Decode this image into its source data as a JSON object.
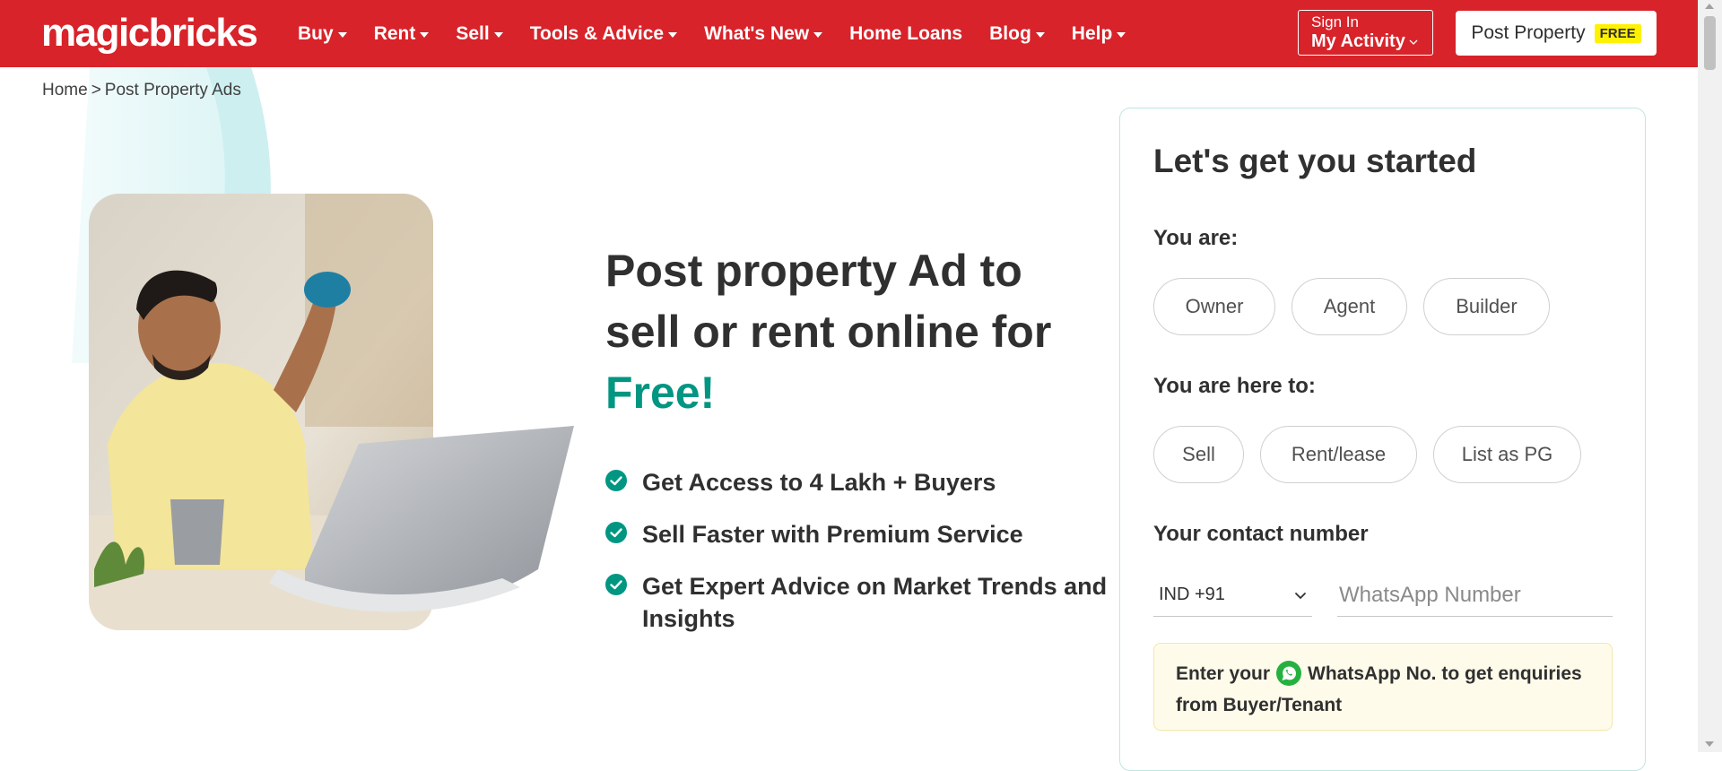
{
  "header": {
    "logo": "magicbricks",
    "nav": [
      {
        "label": "Buy",
        "dropdown": true
      },
      {
        "label": "Rent",
        "dropdown": true
      },
      {
        "label": "Sell",
        "dropdown": true
      },
      {
        "label": "Tools & Advice",
        "dropdown": true
      },
      {
        "label": "What's New",
        "dropdown": true
      },
      {
        "label": "Home Loans",
        "dropdown": false
      },
      {
        "label": "Blog",
        "dropdown": true
      },
      {
        "label": "Help",
        "dropdown": true
      }
    ],
    "signin": {
      "line1": "Sign In",
      "line2": "My Activity"
    },
    "post_property": {
      "label": "Post Property",
      "badge": "FREE"
    },
    "brand_color": "#d8232a"
  },
  "breadcrumb": {
    "home": "Home",
    "separator": ">",
    "current": "Post Property Ads"
  },
  "hero": {
    "title_line1": "Post property Ad to",
    "title_line2": "sell or rent online for",
    "title_highlight": "Free!",
    "highlight_color": "#009681",
    "benefits": [
      "Get Access to 4 Lakh + Buyers",
      "Sell Faster with Premium Service",
      "Get Expert Advice on Market Trends and Insights"
    ]
  },
  "form": {
    "title": "Let's get you started",
    "you_are_label": "You are:",
    "you_are_options": [
      "Owner",
      "Agent",
      "Builder"
    ],
    "purpose_label": "You are here to:",
    "purpose_options": [
      "Sell",
      "Rent/lease",
      "List as PG"
    ],
    "contact_label": "Your contact number",
    "country_code": "IND +91",
    "phone_placeholder": "WhatsApp Number",
    "notice_prefix": "Enter your",
    "notice_suffix": "WhatsApp No. to get enquiries from Buyer/Tenant"
  }
}
